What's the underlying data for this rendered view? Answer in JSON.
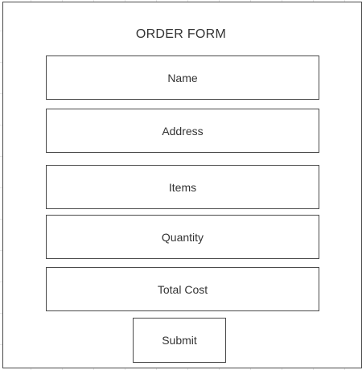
{
  "form": {
    "title": "ORDER FORM",
    "fields": [
      {
        "label": "Name"
      },
      {
        "label": "Address"
      },
      {
        "label": "Items"
      },
      {
        "label": "Quantity"
      },
      {
        "label": "Total Cost"
      }
    ],
    "submit_label": "Submit"
  }
}
